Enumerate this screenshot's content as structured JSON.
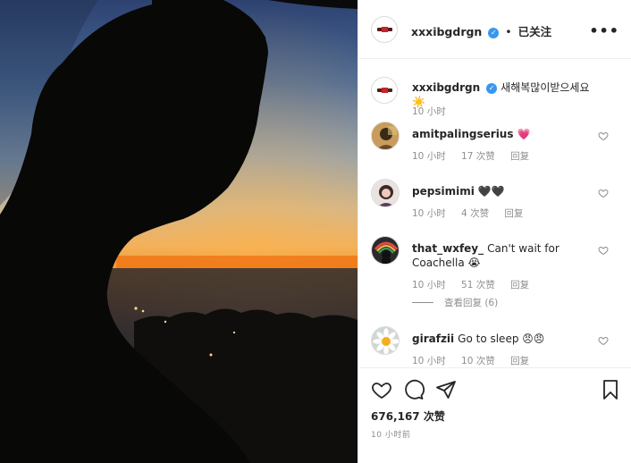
{
  "post": {
    "author": "xxxibgdrgn",
    "follow_state": "已关注",
    "header_separator": "•",
    "more_label": "•••"
  },
  "caption": {
    "author": "xxxibgdrgn",
    "text": "새해복많이받으세요☀️",
    "time": "10 小时"
  },
  "comments": [
    {
      "user": "amitpalingserius",
      "text": "💗",
      "time": "10 小时",
      "likes": "17 次赞",
      "reply": "回复",
      "avatar_icon": "profile-photo"
    },
    {
      "user": "pepsimimi",
      "text": "🖤🖤",
      "time": "10 小时",
      "likes": "4 次赞",
      "reply": "回复",
      "avatar_icon": "profile-photo"
    },
    {
      "user": "that_wxfey_",
      "text": "Can't wait for Coachella 😭",
      "time": "10 小时",
      "likes": "51 次赞",
      "reply": "回复",
      "avatar_icon": "profile-photo",
      "view_replies": "查看回复 (6)"
    },
    {
      "user": "girafzii",
      "text": "Go to sleep 😠😠",
      "time": "10 小时",
      "likes": "10 次赞",
      "reply": "回复",
      "avatar_icon": "daisy-photo"
    }
  ],
  "footer": {
    "likes_count": "676,167 次赞",
    "posted_time": "10 小时前"
  },
  "icons": {
    "like": "heart-icon",
    "comment": "comment-icon",
    "share": "share-icon",
    "save": "bookmark-icon",
    "verified": "verified-badge-icon",
    "more": "more-options-icon"
  },
  "colors": {
    "verified": "#3897f0",
    "secondary_text": "#8e8e8e",
    "primary_text": "#262626",
    "border": "#efefef"
  }
}
